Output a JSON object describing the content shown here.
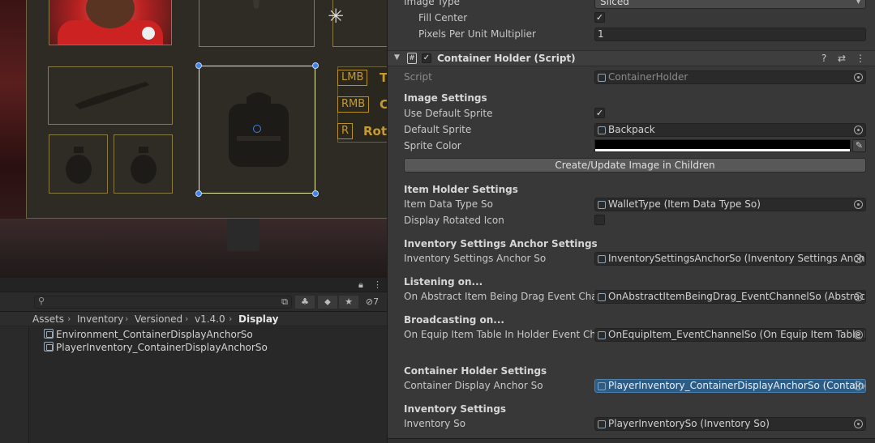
{
  "scene": {
    "keys": [
      {
        "key": "LMB",
        "desc": "T"
      },
      {
        "key": "RMB",
        "desc": "C"
      },
      {
        "key": "R",
        "desc": "Rot"
      }
    ]
  },
  "project": {
    "search": {
      "placeholder": ""
    },
    "hidden_count": "7",
    "breadcrumbs": [
      "Assets",
      "Inventory",
      "Versioned",
      "v1.4.0",
      "Display"
    ],
    "assets": [
      "Environment_ContainerDisplayAnchorSo",
      "PlayerInventory_ContainerDisplayAnchorSo"
    ]
  },
  "inspector": {
    "image_type": {
      "label": "Image Type",
      "value": "Sliced"
    },
    "fill_center": {
      "label": "Fill Center",
      "checked": true
    },
    "ppu": {
      "label": "Pixels Per Unit Multiplier",
      "value": "1"
    },
    "component": {
      "title": "Container Holder (Script)",
      "enabled": true
    },
    "script": {
      "label": "Script",
      "value": "ContainerHolder"
    },
    "image_settings": {
      "header": "Image Settings",
      "use_default_sprite": {
        "label": "Use Default Sprite",
        "checked": true
      },
      "default_sprite": {
        "label": "Default Sprite",
        "value": "Backpack"
      },
      "sprite_color": {
        "label": "Sprite Color",
        "value": "#000000"
      },
      "create_button": "Create/Update Image in Children"
    },
    "item_holder": {
      "header": "Item Holder Settings",
      "item_data_type": {
        "label": "Item Data Type So",
        "value": "WalletType (Item Data Type So)"
      },
      "display_rotated": {
        "label": "Display Rotated Icon",
        "checked": false
      }
    },
    "anchor_settings": {
      "header": "Inventory Settings Anchor Settings",
      "anchor": {
        "label": "Inventory Settings Anchor So",
        "value": "InventorySettingsAnchorSo (Inventory Settings Ancho"
      }
    },
    "listening": {
      "header": "Listening on...",
      "event": {
        "label": "On Abstract Item Being Drag Event Chann",
        "value": "OnAbstractItemBeingDrag_EventChannelSo (Abstract"
      }
    },
    "broadcasting": {
      "header": "Broadcasting on...",
      "event": {
        "label": "On Equip Item Table In Holder Event Chan",
        "value": "OnEquipItem_EventChannelSo (On Equip Item Table In"
      }
    },
    "container_holder": {
      "header": "Container Holder Settings",
      "anchor": {
        "label": "Container Display Anchor So",
        "value": "PlayerInventory_ContainerDisplayAnchorSo (Containe"
      }
    },
    "inventory": {
      "header": "Inventory Settings",
      "inventory_so": {
        "label": "Inventory So",
        "value": "PlayerInventorySo (Inventory So)"
      }
    }
  },
  "colors": {
    "accent_selection": "#2c5d87",
    "handle_blue": "#3f84e5",
    "key_gold": "#c79a2a"
  }
}
